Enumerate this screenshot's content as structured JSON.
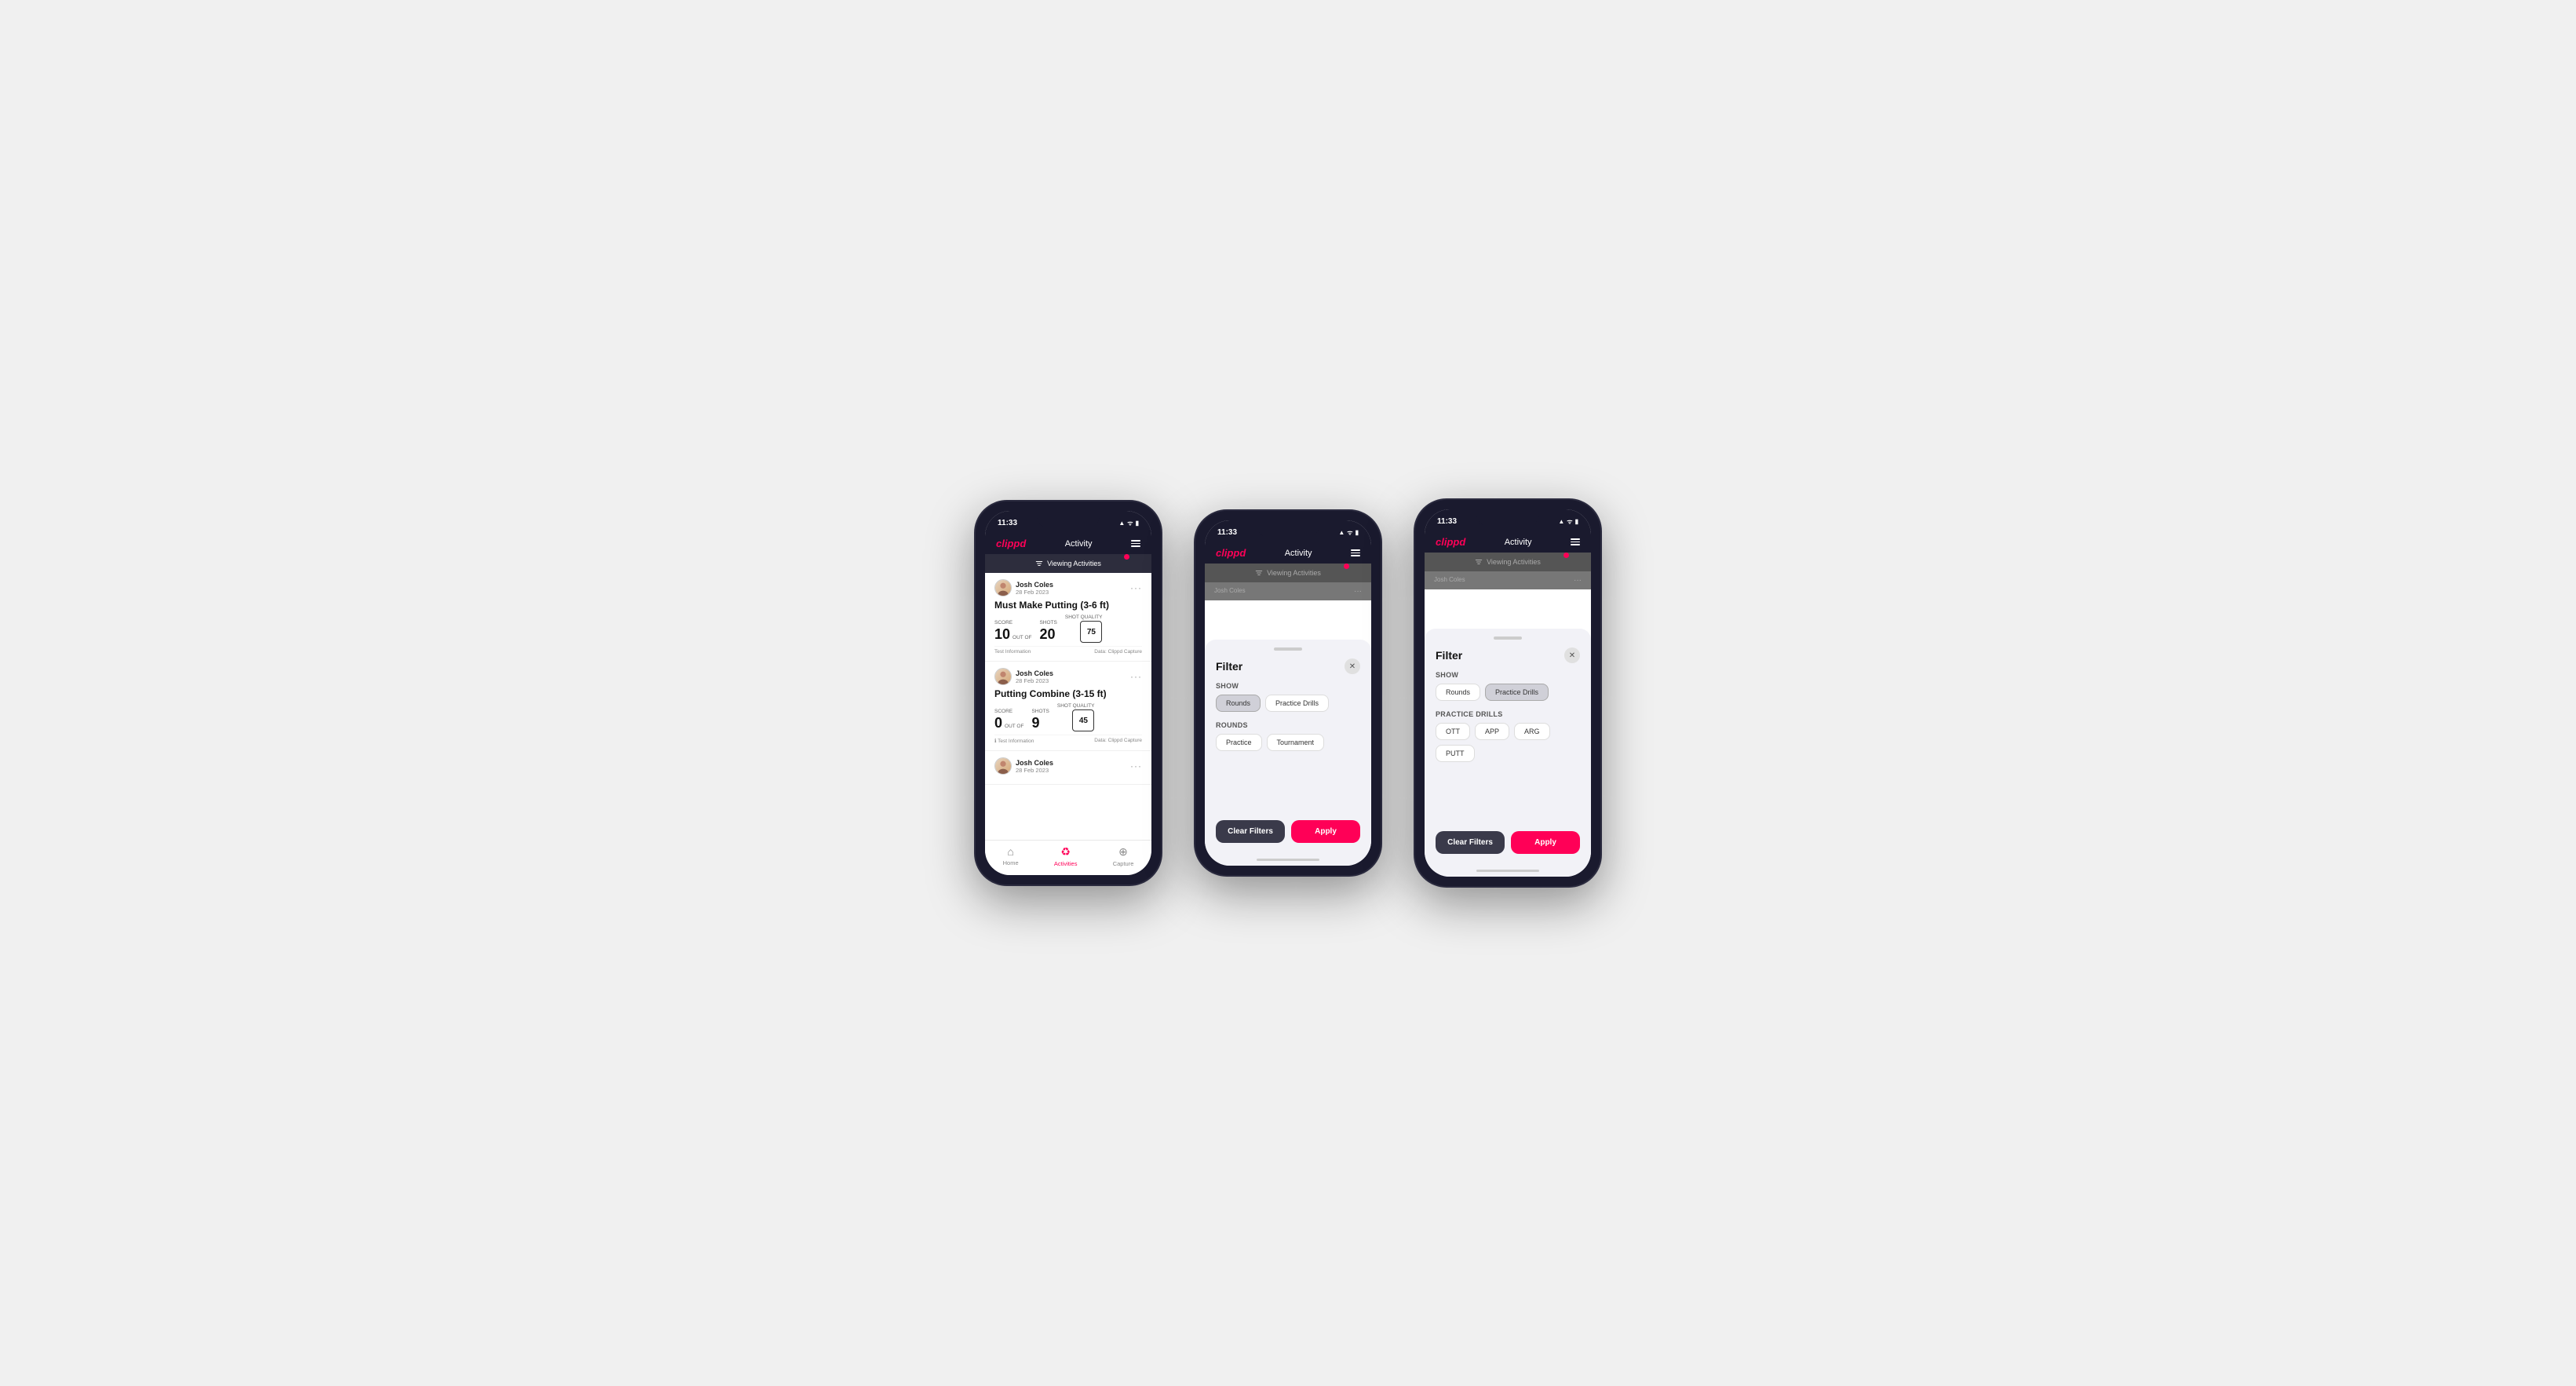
{
  "phones": [
    {
      "id": "phone1",
      "statusBar": {
        "time": "11:33",
        "icons": "▲ ᯤ 🔋"
      },
      "nav": {
        "logo": "clippd",
        "title": "Activity"
      },
      "viewingBar": {
        "text": "Viewing Activities"
      },
      "cards": [
        {
          "user": "Josh Coles",
          "date": "28 Feb 2023",
          "title": "Must Make Putting (3-6 ft)",
          "scoreLabelScore": "Score",
          "scoreLabelShots": "Shots",
          "scoreLabelQuality": "Shot Quality",
          "score": "10",
          "outOf": "OUT OF",
          "shots": "20",
          "quality": "75",
          "footer1": "Test Information",
          "footer2": "Data: Clippd Capture"
        },
        {
          "user": "Josh Coles",
          "date": "28 Feb 2023",
          "title": "Putting Combine (3-15 ft)",
          "scoreLabelScore": "Score",
          "scoreLabelShots": "Shots",
          "scoreLabelQuality": "Shot Quality",
          "score": "0",
          "outOf": "OUT OF",
          "shots": "9",
          "quality": "45",
          "footer1": "Test Information",
          "footer2": "Data: Clippd Capture"
        },
        {
          "user": "Josh Coles",
          "date": "28 Feb 2023",
          "title": "",
          "score": "",
          "shots": "",
          "quality": ""
        }
      ],
      "bottomNav": [
        {
          "icon": "🏠",
          "label": "Home",
          "active": false
        },
        {
          "icon": "♻",
          "label": "Activities",
          "active": true
        },
        {
          "icon": "+",
          "label": "Capture",
          "active": false
        }
      ]
    },
    {
      "id": "phone2",
      "statusBar": {
        "time": "11:33"
      },
      "nav": {
        "logo": "clippd",
        "title": "Activity"
      },
      "viewingBar": {
        "text": "Viewing Activities"
      },
      "filter": {
        "title": "Filter",
        "showLabel": "Show",
        "showChips": [
          {
            "label": "Rounds",
            "active": true
          },
          {
            "label": "Practice Drills",
            "active": false
          }
        ],
        "roundsLabel": "Rounds",
        "roundsChips": [
          {
            "label": "Practice",
            "active": false
          },
          {
            "label": "Tournament",
            "active": false
          }
        ],
        "clearFilters": "Clear Filters",
        "apply": "Apply"
      }
    },
    {
      "id": "phone3",
      "statusBar": {
        "time": "11:33"
      },
      "nav": {
        "logo": "clippd",
        "title": "Activity"
      },
      "viewingBar": {
        "text": "Viewing Activities"
      },
      "filter": {
        "title": "Filter",
        "showLabel": "Show",
        "showChips": [
          {
            "label": "Rounds",
            "active": false
          },
          {
            "label": "Practice Drills",
            "active": true
          }
        ],
        "practiceLabel": "Practice Drills",
        "practiceChips": [
          {
            "label": "OTT",
            "active": false
          },
          {
            "label": "APP",
            "active": false
          },
          {
            "label": "ARG",
            "active": false
          },
          {
            "label": "PUTT",
            "active": false
          }
        ],
        "clearFilters": "Clear Filters",
        "apply": "Apply"
      }
    }
  ]
}
